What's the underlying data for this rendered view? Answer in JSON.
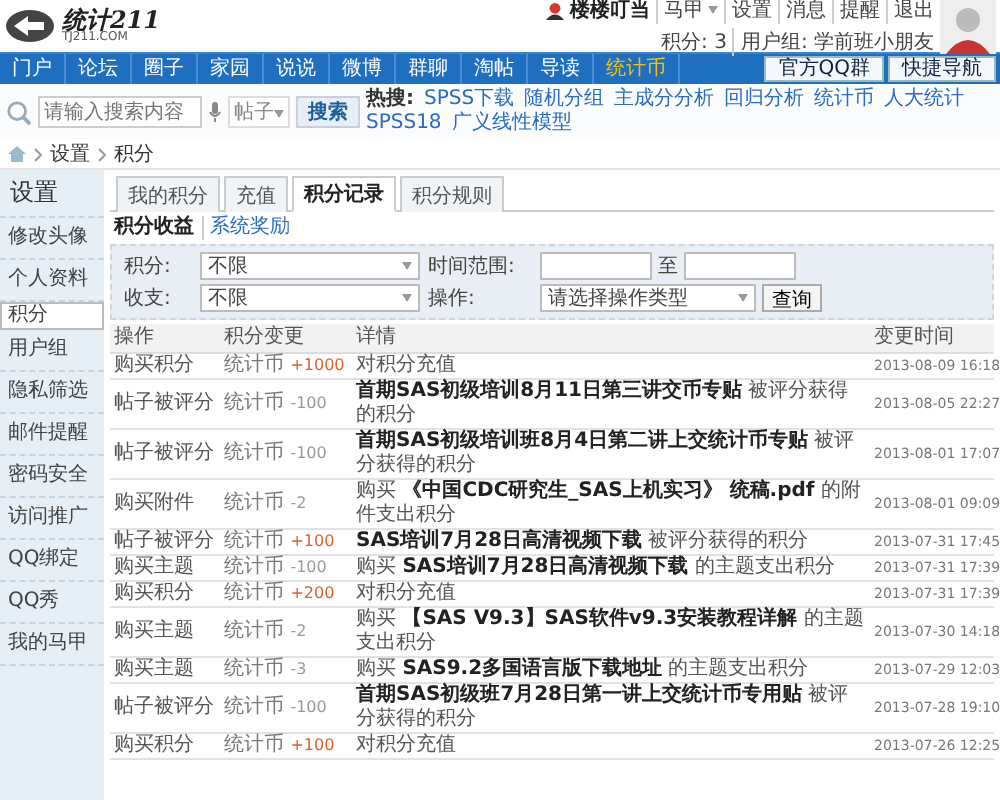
{
  "header": {
    "logo_title": "统计211",
    "logo_subtitle": "TJ211.COM",
    "username": "楼楼叮当",
    "user_links": [
      {
        "label": "马甲",
        "dropdown": true
      },
      {
        "label": "设置",
        "dropdown": false
      },
      {
        "label": "消息",
        "dropdown": false
      },
      {
        "label": "提醒",
        "dropdown": false
      },
      {
        "label": "退出",
        "dropdown": false
      }
    ],
    "points": "积分: 3",
    "usergroup": "用户组: 学前班小朋友"
  },
  "nav": {
    "items": [
      {
        "label": "门户",
        "highlight": false
      },
      {
        "label": "论坛",
        "highlight": false
      },
      {
        "label": "圈子",
        "highlight": false
      },
      {
        "label": "家园",
        "highlight": false
      },
      {
        "label": "说说",
        "highlight": false
      },
      {
        "label": "微博",
        "highlight": false
      },
      {
        "label": "群聊",
        "highlight": false
      },
      {
        "label": "淘帖",
        "highlight": false
      },
      {
        "label": "导读",
        "highlight": false
      },
      {
        "label": "统计币",
        "highlight": true
      }
    ],
    "buttons": [
      "官方QQ群",
      "快捷导航"
    ]
  },
  "search": {
    "placeholder": "请输入搜索内容",
    "scope": "帖子",
    "button": "搜索",
    "hot_label": "热搜:",
    "hot_words": [
      "SPSS下载",
      "随机分组",
      "主成分分析",
      "回归分析",
      "统计币",
      "人大统计",
      "SPSS18",
      "广义线性模型"
    ]
  },
  "breadcrumb": [
    "设置",
    "积分"
  ],
  "sidebar": {
    "title": "设置",
    "items": [
      {
        "label": "修改头像",
        "selected": false
      },
      {
        "label": "个人资料",
        "selected": false
      },
      {
        "label": "积分",
        "selected": true
      },
      {
        "label": "用户组",
        "selected": false
      },
      {
        "label": "隐私筛选",
        "selected": false
      },
      {
        "label": "邮件提醒",
        "selected": false
      },
      {
        "label": "密码安全",
        "selected": false
      },
      {
        "label": "访问推广",
        "selected": false
      },
      {
        "label": "QQ绑定",
        "selected": false
      },
      {
        "label": "QQ秀",
        "selected": false
      },
      {
        "label": "我的马甲",
        "selected": false
      }
    ]
  },
  "tabs": [
    {
      "label": "我的积分",
      "selected": false
    },
    {
      "label": "充值",
      "selected": false
    },
    {
      "label": "积分记录",
      "selected": true
    },
    {
      "label": "积分规则",
      "selected": false
    }
  ],
  "subtabs": [
    {
      "label": "积分收益",
      "selected": true
    },
    {
      "label": "系统奖励",
      "selected": false
    }
  ],
  "filter": {
    "points_label": "积分:",
    "points_value": "不限",
    "flow_label": "收支:",
    "flow_value": "不限",
    "time_label": "时间范围:",
    "time_separator": "至",
    "action_label": "操作:",
    "action_value": "请选择操作类型",
    "query_button": "查询"
  },
  "table": {
    "columns": [
      "操作",
      "积分变更",
      "详情",
      "变更时间"
    ],
    "rows": [
      {
        "action": "购买积分",
        "unit": "统计币",
        "amount": "+1000",
        "color": "#e0612a",
        "detail": "对积分充值",
        "time": "2013-08-09 16:18"
      },
      {
        "action": "帖子被评分",
        "unit": "统计币",
        "amount": "-100",
        "color": "#999999",
        "detail": "**首期SAS初级培训8月11日第三讲交币专贴** 被评分获得的积分",
        "time": "2013-08-05 22:27"
      },
      {
        "action": "帖子被评分",
        "unit": "统计币",
        "amount": "-100",
        "color": "#999999",
        "detail": "**首期SAS初级培训班8月4日第二讲上交统计币专贴** 被评分获得的积分",
        "time": "2013-08-01 17:07"
      },
      {
        "action": "购买附件",
        "unit": "统计币",
        "amount": "-2",
        "color": "#999999",
        "detail": "购买 **《中国CDC研究生_SAS上机实习》 统稿.pdf** 的附件支出积分",
        "time": "2013-08-01 09:09"
      },
      {
        "action": "帖子被评分",
        "unit": "统计币",
        "amount": "+100",
        "color": "#e0612a",
        "detail": "**SAS培训7月28日高清视频下载** 被评分获得的积分",
        "time": "2013-07-31 17:45"
      },
      {
        "action": "购买主题",
        "unit": "统计币",
        "amount": "-100",
        "color": "#999999",
        "detail": "购买 **SAS培训7月28日高清视频下载** 的主题支出积分",
        "time": "2013-07-31 17:39"
      },
      {
        "action": "购买积分",
        "unit": "统计币",
        "amount": "+200",
        "color": "#e0612a",
        "detail": "对积分充值",
        "time": "2013-07-31 17:39"
      },
      {
        "action": "购买主题",
        "unit": "统计币",
        "amount": "-2",
        "color": "#999999",
        "detail": "购买 **【SAS V9.3】SAS软件v9.3安装教程详解** 的主题支出积分",
        "time": "2013-07-30 14:18"
      },
      {
        "action": "购买主题",
        "unit": "统计币",
        "amount": "-3",
        "color": "#999999",
        "detail": "购买 **SAS9.2多国语言版下载地址** 的主题支出积分",
        "time": "2013-07-29 12:03"
      },
      {
        "action": "帖子被评分",
        "unit": "统计币",
        "amount": "-100",
        "color": "#999999",
        "detail": "**首期SAS初级班7月28日第一讲上交统计币专用贴** 被评分获得的积分",
        "time": "2013-07-28 19:10"
      },
      {
        "action": "购买积分",
        "unit": "统计币",
        "amount": "+100",
        "color": "#e0612a",
        "detail": "对积分充值",
        "time": "2013-07-26 12:25"
      }
    ]
  }
}
